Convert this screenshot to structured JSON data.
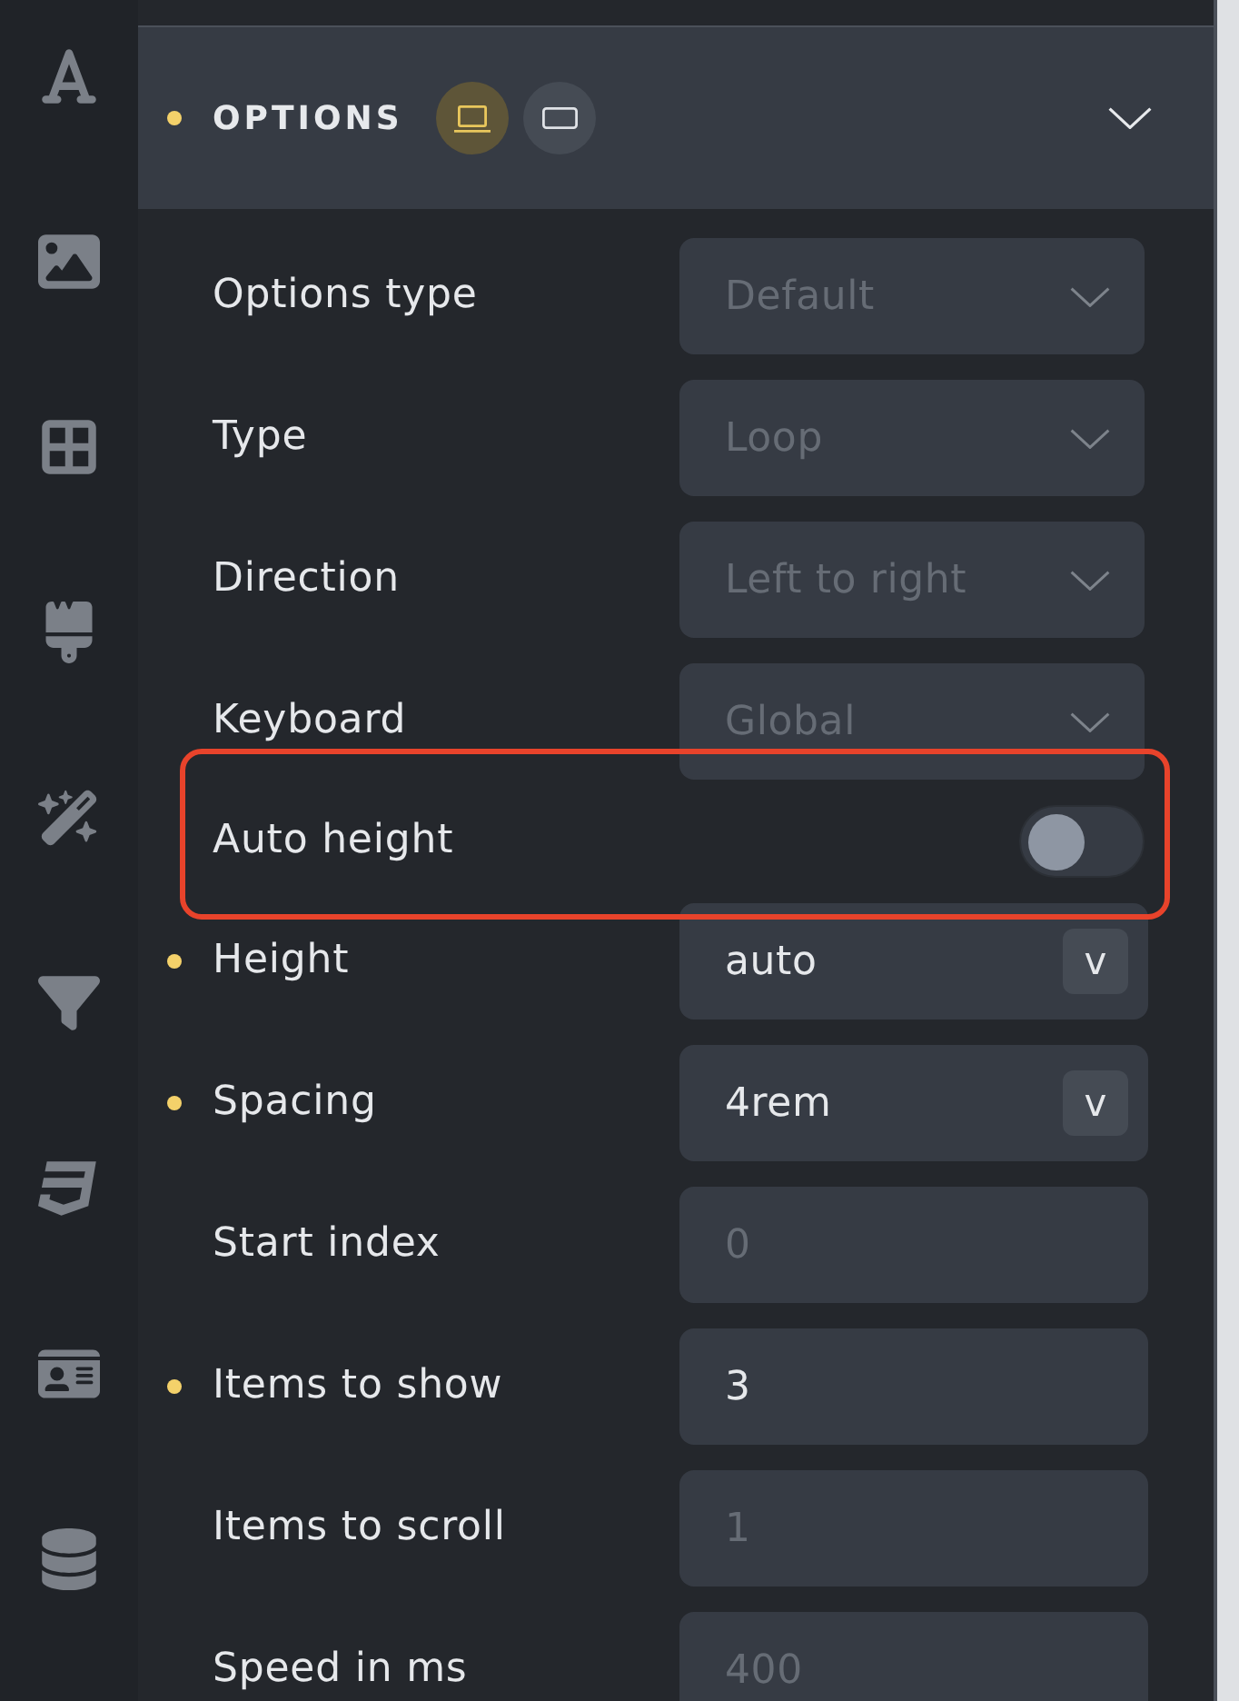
{
  "section": {
    "title": "OPTIONS",
    "modified": true,
    "expanded": true,
    "device_toggles": [
      {
        "selected": true
      },
      {
        "selected": false
      }
    ]
  },
  "rows": [
    {
      "kind": "select",
      "label": "Options type",
      "modified": false,
      "highlighted": false,
      "placeholder": "Default"
    },
    {
      "kind": "select",
      "label": "Type",
      "modified": false,
      "highlighted": false,
      "placeholder": "Loop"
    },
    {
      "kind": "select",
      "label": "Direction",
      "modified": false,
      "highlighted": false,
      "placeholder": "Left to right"
    },
    {
      "kind": "select",
      "label": "Keyboard",
      "modified": false,
      "highlighted": false,
      "placeholder": "Global"
    },
    {
      "kind": "toggle",
      "label": "Auto height",
      "modified": false,
      "highlighted": true,
      "on": false
    },
    {
      "kind": "unit-input",
      "label": "Height",
      "modified": true,
      "highlighted": false,
      "value": "auto",
      "unit": "v"
    },
    {
      "kind": "unit-input",
      "label": "Spacing",
      "modified": true,
      "highlighted": false,
      "value": "4rem",
      "unit": "v"
    },
    {
      "kind": "input",
      "label": "Start index",
      "modified": false,
      "highlighted": false,
      "placeholder": "0"
    },
    {
      "kind": "input",
      "label": "Items to show",
      "modified": true,
      "highlighted": false,
      "value": "3"
    },
    {
      "kind": "input",
      "label": "Items to scroll",
      "modified": false,
      "highlighted": false,
      "placeholder": "1"
    },
    {
      "kind": "input",
      "label": "Speed in ms",
      "modified": false,
      "highlighted": false,
      "placeholder": "400"
    }
  ]
}
